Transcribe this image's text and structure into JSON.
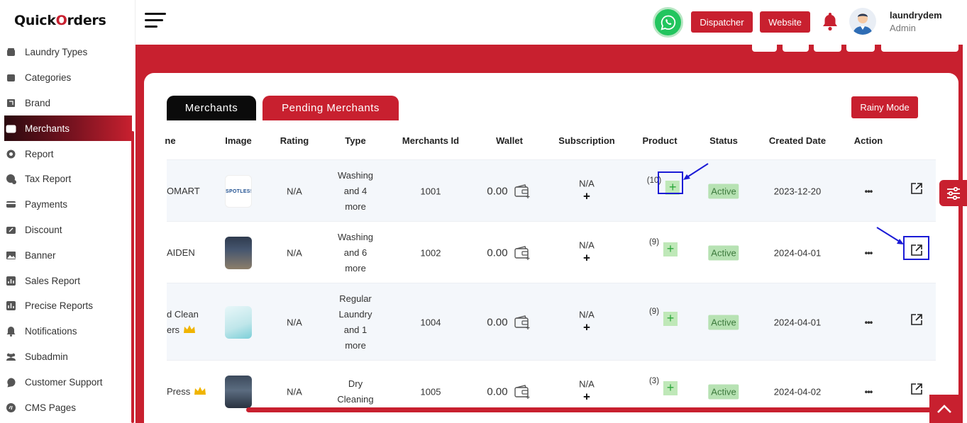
{
  "brand": {
    "logo_pre": "Quick",
    "logo_o": "O",
    "logo_post": "rders"
  },
  "sidebar": {
    "items": [
      {
        "label": "Laundry Types",
        "icon": "laundry-icon"
      },
      {
        "label": "Categories",
        "icon": "categories-icon"
      },
      {
        "label": "Brand",
        "icon": "brand-icon"
      },
      {
        "label": "Merchants",
        "icon": "merchants-icon",
        "active": true
      },
      {
        "label": "Report",
        "icon": "report-icon"
      },
      {
        "label": "Tax Report",
        "icon": "tax-report-icon"
      },
      {
        "label": "Payments",
        "icon": "payments-icon"
      },
      {
        "label": "Discount",
        "icon": "discount-icon"
      },
      {
        "label": "Banner",
        "icon": "banner-icon"
      },
      {
        "label": "Sales Report",
        "icon": "sales-report-icon"
      },
      {
        "label": "Precise Reports",
        "icon": "precise-reports-icon"
      },
      {
        "label": "Notifications",
        "icon": "bell-icon"
      },
      {
        "label": "Subadmin",
        "icon": "subadmin-icon"
      },
      {
        "label": "Customer Support",
        "icon": "support-icon"
      },
      {
        "label": "CMS Pages",
        "icon": "cms-icon"
      }
    ]
  },
  "topbar": {
    "dispatcher_label": "Dispatcher",
    "website_label": "Website",
    "user_name": "laundrydem",
    "user_role": "Admin"
  },
  "tabs": {
    "merchants": "Merchants",
    "pending": "Pending Merchants"
  },
  "rainy_mode_label": "Rainy Mode",
  "table": {
    "headers": {
      "name": "ne",
      "image": "Image",
      "rating": "Rating",
      "type": "Type",
      "merchant_id": "Merchants Id",
      "wallet": "Wallet",
      "subscription": "Subscription",
      "product": "Product",
      "status": "Status",
      "created": "Created Date",
      "action": "Action"
    },
    "rows": [
      {
        "name": "OMART",
        "name2": "",
        "crown": false,
        "rating": "N/A",
        "type": [
          "Washing",
          "and 4",
          "more"
        ],
        "id": "1001",
        "wallet": "0.00",
        "subscription": "N/A",
        "plus": "+",
        "product_count": "(10)",
        "status": "Active",
        "created": "2023-12-20",
        "dots": "•••"
      },
      {
        "name": "AIDEN",
        "name2": "",
        "crown": false,
        "rating": "N/A",
        "type": [
          "Washing",
          "and 6",
          "more"
        ],
        "id": "1002",
        "wallet": "0.00",
        "subscription": "N/A",
        "plus": "+",
        "product_count": "(9)",
        "status": "Active",
        "created": "2024-04-01",
        "dots": "•••"
      },
      {
        "name": "d Clean",
        "name2": "ers",
        "crown": true,
        "rating": "N/A",
        "type": [
          "Regular",
          "Laundry",
          "and 1",
          "more"
        ],
        "id": "1004",
        "wallet": "0.00",
        "subscription": "N/A",
        "plus": "+",
        "product_count": "(9)",
        "status": "Active",
        "created": "2024-04-01",
        "dots": "•••"
      },
      {
        "name": "Press",
        "name2": "",
        "crown": true,
        "rating": "N/A",
        "type": [
          "Dry",
          "Cleaning"
        ],
        "id": "1005",
        "wallet": "0.00",
        "subscription": "N/A",
        "plus": "+",
        "product_count": "(3)",
        "status": "Active",
        "created": "2024-04-02",
        "dots": "•••"
      }
    ]
  },
  "thumb_text": "SPOTLESS",
  "colors": {
    "accent": "#c8202f",
    "status_bg": "#b7e2b3",
    "highlight": "#1b1bd6"
  }
}
